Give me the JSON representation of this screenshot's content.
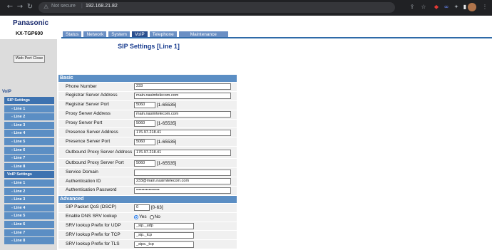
{
  "browser": {
    "security_text": "Not secure",
    "separator": "|",
    "url": "192.168.21.82",
    "icons": [
      "back-icon",
      "forward-icon",
      "reload-icon",
      "share-icon",
      "bookmark-star-icon",
      "extension-red-icon",
      "link-icon",
      "puzzle-icon",
      "sidebar-icon",
      "profile-avatar",
      "menu-icon"
    ]
  },
  "header": {
    "brand": "Panasonic",
    "model": "KX-TGP600",
    "tabs": [
      "Status",
      "Network",
      "System",
      "VoIP",
      "Telephone",
      "Maintenance"
    ],
    "active_tab": "VoIP"
  },
  "sidebar": {
    "web_port_close": "Web Port Close",
    "section_label": "VoIP",
    "sip_header": "SIP Settings",
    "sip_lines": [
      "- Line 1",
      "- Line 2",
      "- Line 3",
      "- Line 4",
      "- Line 5",
      "- Line 6",
      "- Line 7",
      "- Line 8"
    ],
    "voip_header": "VoIP Settings",
    "voip_lines": [
      "- Line 1",
      "- Line 2",
      "- Line 3",
      "- Line 4",
      "- Line 5",
      "- Line 6",
      "- Line 7",
      "- Line 8"
    ]
  },
  "main": {
    "title": "SIP Settings [Line 1]",
    "basic_header": "Basic",
    "advanced_header": "Advanced",
    "phone_number_label": "Phone Number",
    "phone_number_value": "233",
    "registrar_addr_label": "Registrar Server Address",
    "registrar_addr_value": "main.nasimtelecom.com",
    "registrar_port_label": "Registrar Server Port",
    "registrar_port_value": "5060",
    "registrar_port_range": "[1-65535]",
    "proxy_addr_label": "Proxy Server Address",
    "proxy_addr_value": "main.nasimtelecom.com",
    "proxy_port_label": "Proxy Server Port",
    "proxy_port_value": "5060",
    "proxy_port_range": "[1-65535]",
    "presence_addr_label": "Presence Server Address",
    "presence_addr_value": "176.97.218.41",
    "presence_port_label": "Presence Server Port",
    "presence_port_value": "5060",
    "presence_port_range": "[1-65535]",
    "outbound_addr_label": "Outbound Proxy Server Address",
    "outbound_addr_value": "176.97.218.41",
    "outbound_port_label": "Outbound Proxy Server Port",
    "outbound_port_value": "5060",
    "outbound_port_range": "[1-65535]",
    "service_domain_label": "Service Domain",
    "service_domain_value": "",
    "auth_id_label": "Authentication ID",
    "auth_id_value": "233@main.nasimtelecom.com",
    "auth_pw_label": "Authentication Password",
    "auth_pw_value": "•••••••••••••••••",
    "dscp_label": "SIP Packet QoS (DSCP)",
    "dscp_value": "0",
    "dscp_range": "[0-63]",
    "dns_srv_label": "Enable DNS SRV lookup",
    "dns_srv_yes": "Yes",
    "dns_srv_no": "No",
    "dns_srv_selected": "Yes",
    "srv_udp_label": "SRV lookup Prefix for UDP",
    "srv_udp_value": "_sip._udp",
    "srv_tcp_label": "SRV lookup Prefix for TCP",
    "srv_tcp_value": "_sip._tcp",
    "srv_tls_label": "SRV lookup Prefix for TLS",
    "srv_tls_value": "_sips._tcp"
  },
  "colors": {
    "chrome_bg": "#202124",
    "tab_active": "#2a4f8f",
    "tab": "#6a8fc4",
    "menu_item": "#5b8ec4",
    "section_header": "#5b8ec4",
    "title": "#1a3d8f"
  }
}
